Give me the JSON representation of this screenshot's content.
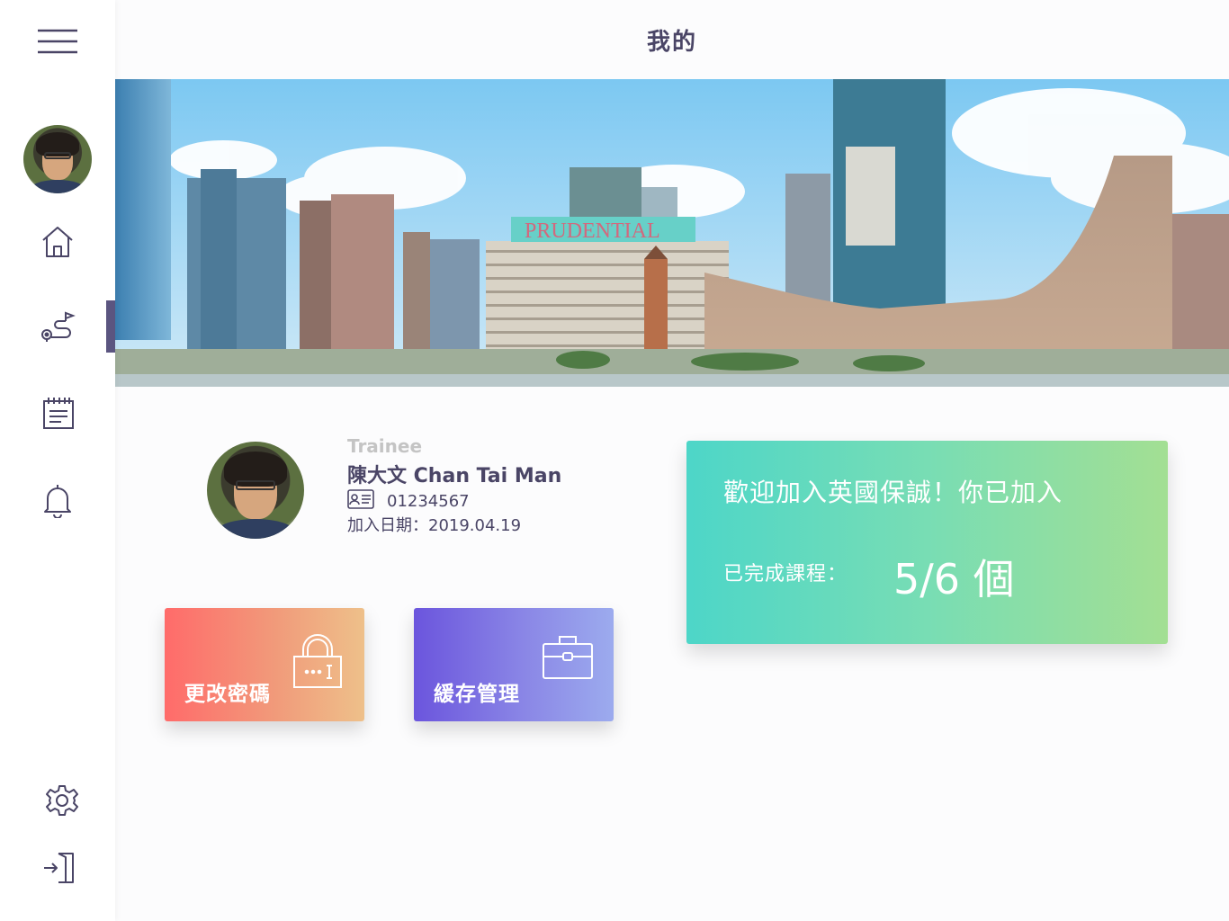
{
  "header": {
    "title": "我的"
  },
  "sidebar": {
    "items": [
      {
        "name": "menu-icon"
      },
      {
        "name": "avatar"
      },
      {
        "name": "home-icon"
      },
      {
        "name": "route-icon",
        "active": true
      },
      {
        "name": "calendar-icon"
      },
      {
        "name": "bell-icon"
      },
      {
        "name": "gear-icon"
      },
      {
        "name": "logout-icon"
      }
    ],
    "active_color": "#5b5580"
  },
  "banner": {
    "sign_text": "PRUDENTIAL"
  },
  "profile": {
    "role": "Trainee",
    "name": "陳大文 Chan Tai Man",
    "id_number": "01234567",
    "joined": "加入日期：2019.04.19"
  },
  "actions": {
    "change_password": "更改密碼",
    "cache_management": "緩存管理"
  },
  "welcome": {
    "message": "歡迎加入英國保誠！你已加入",
    "completed_label": "已完成課程：",
    "completed_value": "5/6 個"
  },
  "colors": {
    "text_primary": "#4a4566",
    "password_gradient": [
      "#ff6b6a",
      "#eec08a"
    ],
    "cache_gradient": [
      "#6b55dd",
      "#9cabee"
    ],
    "welcome_gradient": [
      "#4dd6c8",
      "#a3df93"
    ]
  }
}
